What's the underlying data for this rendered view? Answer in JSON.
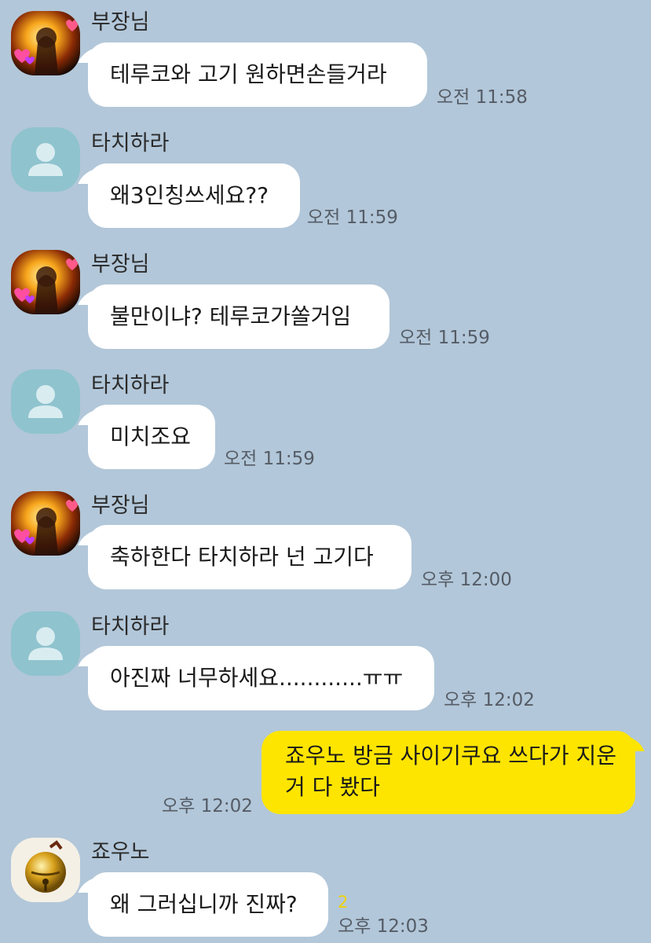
{
  "colors": {
    "background": "#b2c7d9",
    "incoming_bubble": "#ffffff",
    "outgoing_bubble": "#fee500",
    "unread_count": "#f0d300",
    "time_text": "#555c66"
  },
  "messages": [
    {
      "sender": "부장님",
      "text": "테루코와 고기 원하면손들거라",
      "time": "오전 11:58",
      "avatar": "fiery-character-heart-icon"
    },
    {
      "sender": "타치하라",
      "text": "왜3인칭쓰세요??",
      "time": "오전 11:59",
      "avatar": "default-person-icon"
    },
    {
      "sender": "부장님",
      "text": "불만이냐? 테루코가쏠거임",
      "time": "오전 11:59",
      "avatar": "fiery-character-heart-icon"
    },
    {
      "sender": "타치하라",
      "text": "미치조요",
      "time": "오전 11:59",
      "avatar": "default-person-icon"
    },
    {
      "sender": "부장님",
      "text": "축하한다 타치하라 넌 고기다",
      "time": "오후 12:00",
      "avatar": "fiery-character-heart-icon"
    },
    {
      "sender": "타치하라",
      "text": "아진짜 너무하세요............ㅠㅠ",
      "time": "오후 12:02",
      "avatar": "default-person-icon"
    },
    {
      "sender": "",
      "text": "죠우노 방금 사이기쿠요 쓰다가 지운 거 다 봤다",
      "time": "오후 12:02",
      "outgoing": true
    },
    {
      "sender": "죠우노",
      "text": "왜 그러십니까 진짜?",
      "time": "오후 12:03",
      "unread": "2",
      "avatar": "golden-bell-icon"
    }
  ]
}
